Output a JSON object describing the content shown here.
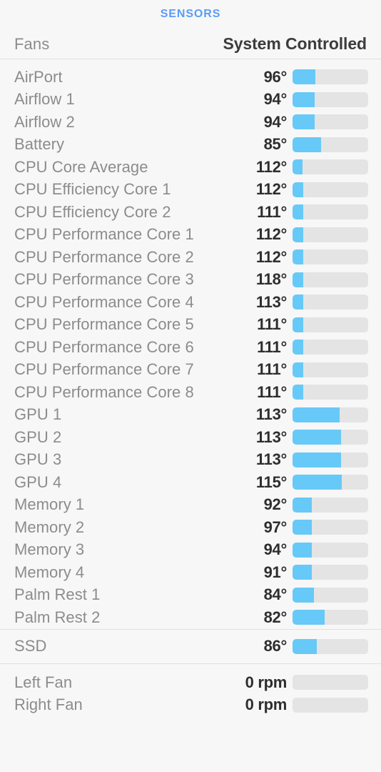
{
  "header": {
    "title": "SENSORS",
    "fans_label": "Fans",
    "fans_mode": "System Controlled",
    "accent_color": "#5a9cf8",
    "bar_fill_color": "#67c9f7",
    "bar_track_color": "#e4e4e4"
  },
  "groups": [
    {
      "id": "temperatures",
      "rows": [
        {
          "name": "AirPort",
          "value": "96°",
          "percent": 30
        },
        {
          "name": "Airflow 1",
          "value": "94°",
          "percent": 29
        },
        {
          "name": "Airflow 2",
          "value": "94°",
          "percent": 29
        },
        {
          "name": "Battery",
          "value": "85°",
          "percent": 38
        },
        {
          "name": "CPU Core Average",
          "value": "112°",
          "percent": 13
        },
        {
          "name": "CPU Efficiency Core 1",
          "value": "112°",
          "percent": 14
        },
        {
          "name": "CPU Efficiency Core 2",
          "value": "111°",
          "percent": 14
        },
        {
          "name": "CPU Performance Core 1",
          "value": "112°",
          "percent": 14
        },
        {
          "name": "CPU Performance Core 2",
          "value": "112°",
          "percent": 14
        },
        {
          "name": "CPU Performance Core 3",
          "value": "118°",
          "percent": 14
        },
        {
          "name": "CPU Performance Core 4",
          "value": "113°",
          "percent": 14
        },
        {
          "name": "CPU Performance Core 5",
          "value": "111°",
          "percent": 14
        },
        {
          "name": "CPU Performance Core 6",
          "value": "111°",
          "percent": 14
        },
        {
          "name": "CPU Performance Core 7",
          "value": "111°",
          "percent": 14
        },
        {
          "name": "CPU Performance Core 8",
          "value": "111°",
          "percent": 14
        },
        {
          "name": "GPU 1",
          "value": "113°",
          "percent": 62
        },
        {
          "name": "GPU 2",
          "value": "113°",
          "percent": 64
        },
        {
          "name": "GPU 3",
          "value": "113°",
          "percent": 64
        },
        {
          "name": "GPU 4",
          "value": "115°",
          "percent": 65
        },
        {
          "name": "Memory 1",
          "value": "92°",
          "percent": 25
        },
        {
          "name": "Memory 2",
          "value": "97°",
          "percent": 25
        },
        {
          "name": "Memory 3",
          "value": "94°",
          "percent": 25
        },
        {
          "name": "Memory 4",
          "value": "91°",
          "percent": 25
        },
        {
          "name": "Palm Rest 1",
          "value": "84°",
          "percent": 28
        },
        {
          "name": "Palm Rest 2",
          "value": "82°",
          "percent": 42
        }
      ]
    },
    {
      "id": "storage",
      "rows": [
        {
          "name": "SSD",
          "value": "86°",
          "percent": 32
        }
      ]
    },
    {
      "id": "fans",
      "rows": [
        {
          "name": "Left Fan",
          "value": "0 rpm",
          "percent": 0
        },
        {
          "name": "Right Fan",
          "value": "0 rpm",
          "percent": 0
        }
      ]
    }
  ]
}
